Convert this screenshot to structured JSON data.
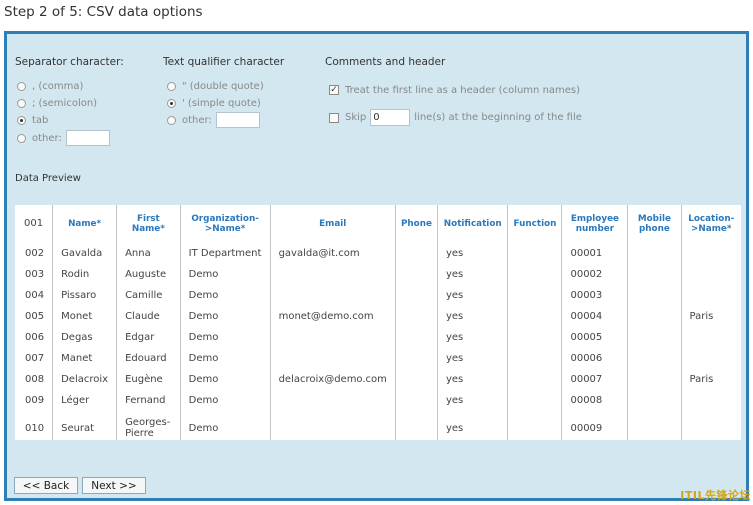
{
  "step_title": "Step 2 of 5: CSV data options",
  "separator": {
    "title": "Separator character:",
    "options": [
      ", (comma)",
      "; (semicolon)",
      "tab",
      "other:"
    ],
    "selected": "tab",
    "other_value": ""
  },
  "qualifier": {
    "title": "Text qualifier character",
    "options": [
      "\" (double quote)",
      "' (simple quote)",
      "other:"
    ],
    "selected": "' (simple quote)",
    "other_value": ""
  },
  "comments": {
    "title": "Comments and header",
    "header_label": "Treat the first line as a header (column names)",
    "header_checked": true,
    "skip_label": "Skip",
    "skip_value": "0",
    "skip_suffix": "line(s) at the beginning of the file",
    "skip_checked": false
  },
  "preview": {
    "title": "Data Preview",
    "header_row_num": "001",
    "columns": [
      "Name*",
      "First Name*",
      "Organization->Name*",
      "Email",
      "Phone",
      "Notification",
      "Function",
      "Employee number",
      "Mobile phone",
      "Location->Name*"
    ],
    "rows": [
      {
        "num": "002",
        "cells": [
          "Gavalda",
          "Anna",
          "IT Department",
          "gavalda@it.com",
          "",
          "yes",
          "",
          "00001",
          "",
          ""
        ]
      },
      {
        "num": "003",
        "cells": [
          "Rodin",
          "Auguste",
          "Demo",
          "",
          "",
          "yes",
          "",
          "00002",
          "",
          ""
        ]
      },
      {
        "num": "004",
        "cells": [
          "Pissaro",
          "Camille",
          "Demo",
          "",
          "",
          "yes",
          "",
          "00003",
          "",
          ""
        ]
      },
      {
        "num": "005",
        "cells": [
          "Monet",
          "Claude",
          "Demo",
          "monet@demo.com",
          "",
          "yes",
          "",
          "00004",
          "",
          "Paris"
        ]
      },
      {
        "num": "006",
        "cells": [
          "Degas",
          "Edgar",
          "Demo",
          "",
          "",
          "yes",
          "",
          "00005",
          "",
          ""
        ]
      },
      {
        "num": "007",
        "cells": [
          "Manet",
          "Edouard",
          "Demo",
          "",
          "",
          "yes",
          "",
          "00006",
          "",
          ""
        ]
      },
      {
        "num": "008",
        "cells": [
          "Delacroix",
          "Eugène",
          "Demo",
          "delacroix@demo.com",
          "",
          "yes",
          "",
          "00007",
          "",
          "Paris"
        ]
      },
      {
        "num": "009",
        "cells": [
          "Léger",
          "Fernand",
          "Demo",
          "",
          "",
          "yes",
          "",
          "00008",
          "",
          ""
        ]
      },
      {
        "num": "010",
        "cells": [
          "Seurat",
          "Georges-Pierre",
          "Demo",
          "",
          "",
          "yes",
          "",
          "00009",
          "",
          ""
        ]
      }
    ]
  },
  "buttons": {
    "back": "<< Back",
    "next": "Next >>"
  },
  "watermark": "ITIL先锋论坛"
}
